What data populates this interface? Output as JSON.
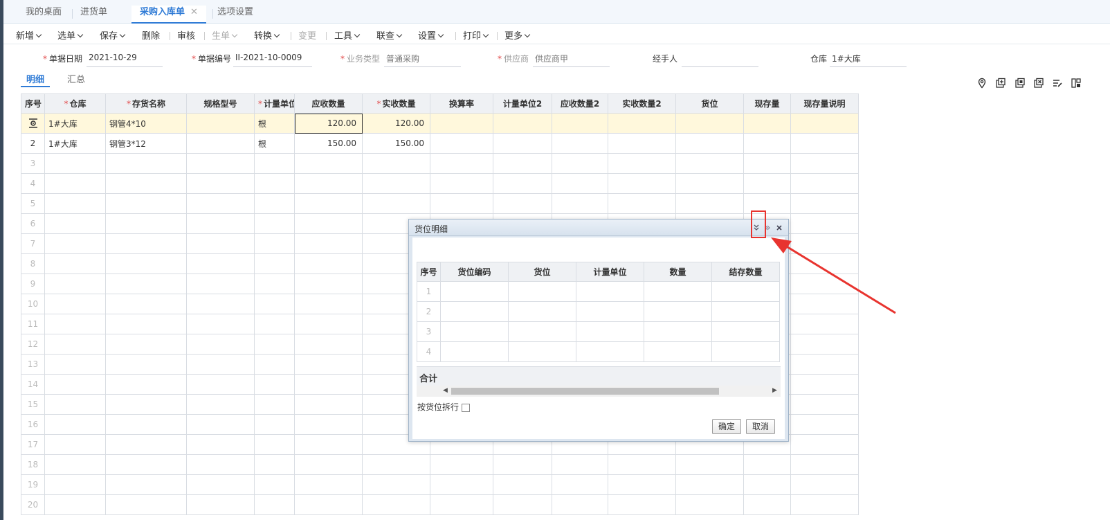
{
  "tabs": [
    {
      "label": "我的桌面"
    },
    {
      "label": "进货单"
    },
    {
      "label": "采购入库单",
      "close": "✕"
    },
    {
      "label": "选项设置"
    }
  ],
  "toolbar": {
    "new": "新增",
    "select": "选单",
    "save": "保存",
    "delete": "删除",
    "audit": "审核",
    "gen": "生单",
    "convert": "转换",
    "change": "变更",
    "tools": "工具",
    "link": "联查",
    "settings": "设置",
    "print": "打印",
    "more": "更多"
  },
  "form": {
    "date_label": "单据日期",
    "date_value": "2021-10-29",
    "no_label": "单据编号",
    "no_value": "II-2021-10-0009",
    "type_label": "业务类型",
    "type_value": "普通采购",
    "supplier_label": "供应商",
    "supplier_value": "供应商甲",
    "handler_label": "经手人",
    "handler_value": "",
    "warehouse_label": "仓库",
    "warehouse_value": "1#大库"
  },
  "subtabs": {
    "detail": "明细",
    "summary": "汇总"
  },
  "grid": {
    "columns": [
      "序号",
      "仓库",
      "存货名称",
      "规格型号",
      "计量单位",
      "应收数量",
      "实收数量",
      "换算率",
      "计量单位2",
      "应收数量2",
      "实收数量2",
      "货位",
      "现存量",
      "现存量说明"
    ],
    "rows": [
      {
        "idx": "",
        "warehouse": "1#大库",
        "name": "钢管4*10",
        "spec": "",
        "unit": "根",
        "due": "120.00",
        "actual": "120.00"
      },
      {
        "idx": "2",
        "warehouse": "1#大库",
        "name": "钢管3*12",
        "spec": "",
        "unit": "根",
        "due": "150.00",
        "actual": "150.00"
      }
    ],
    "empty_rows": [
      "3",
      "4",
      "5",
      "6",
      "7",
      "8",
      "9",
      "10",
      "11",
      "12",
      "13",
      "14",
      "15",
      "16",
      "17",
      "18",
      "19",
      "20"
    ]
  },
  "dialog": {
    "title": "货位明细",
    "columns": [
      "序号",
      "货位编码",
      "货位",
      "计量单位",
      "数量",
      "结存数量"
    ],
    "rows": [
      "1",
      "2",
      "3",
      "4"
    ],
    "total_label": "合计",
    "split_label": "按货位拆行",
    "ok": "确定",
    "cancel": "取消"
  },
  "colors": {
    "accent": "#2f7bd6",
    "required": "#e24b4b",
    "annotation": "#e8342f",
    "selected_row": "#fff8dc"
  }
}
